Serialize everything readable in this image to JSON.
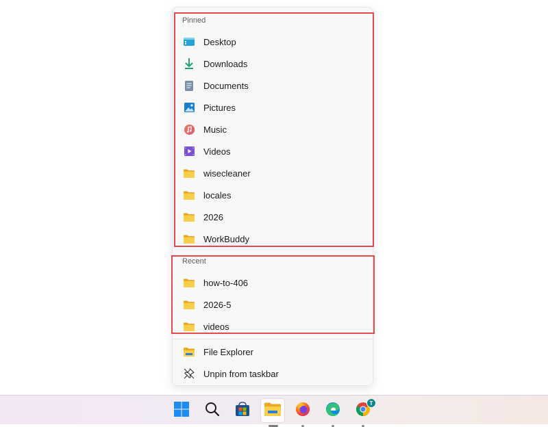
{
  "jumplist": {
    "pinned": {
      "title": "Pinned",
      "items": [
        {
          "label": "Desktop",
          "icon": "desktop-icon"
        },
        {
          "label": "Downloads",
          "icon": "download-icon"
        },
        {
          "label": "Documents",
          "icon": "document-icon"
        },
        {
          "label": "Pictures",
          "icon": "pictures-icon"
        },
        {
          "label": "Music",
          "icon": "music-icon"
        },
        {
          "label": "Videos",
          "icon": "videos-icon"
        },
        {
          "label": "wisecleaner",
          "icon": "folder-icon"
        },
        {
          "label": "locales",
          "icon": "folder-icon"
        },
        {
          "label": "2026",
          "icon": "folder-icon"
        },
        {
          "label": "WorkBuddy",
          "icon": "folder-icon"
        }
      ]
    },
    "recent": {
      "title": "Recent",
      "items": [
        {
          "label": "how-to-406",
          "icon": "folder-icon"
        },
        {
          "label": "2026-5",
          "icon": "folder-icon"
        },
        {
          "label": "videos",
          "icon": "folder-icon"
        }
      ]
    },
    "actions": [
      {
        "label": "File Explorer",
        "icon": "file-explorer-icon"
      },
      {
        "label": "Unpin from taskbar",
        "icon": "unpin-icon"
      }
    ]
  },
  "taskbar": {
    "items": [
      {
        "name": "start",
        "icon": "windows-start-icon"
      },
      {
        "name": "search",
        "icon": "search-icon"
      },
      {
        "name": "store",
        "icon": "microsoft-store-icon"
      },
      {
        "name": "file-explorer",
        "icon": "file-explorer-icon",
        "active": true
      },
      {
        "name": "firefox",
        "icon": "firefox-icon"
      },
      {
        "name": "edge",
        "icon": "edge-icon"
      },
      {
        "name": "chrome",
        "icon": "chrome-icon",
        "badge": "T"
      }
    ]
  },
  "colors": {
    "highlight": "#e5484d",
    "folder": "#f4c542",
    "accent": "#0078d4"
  }
}
